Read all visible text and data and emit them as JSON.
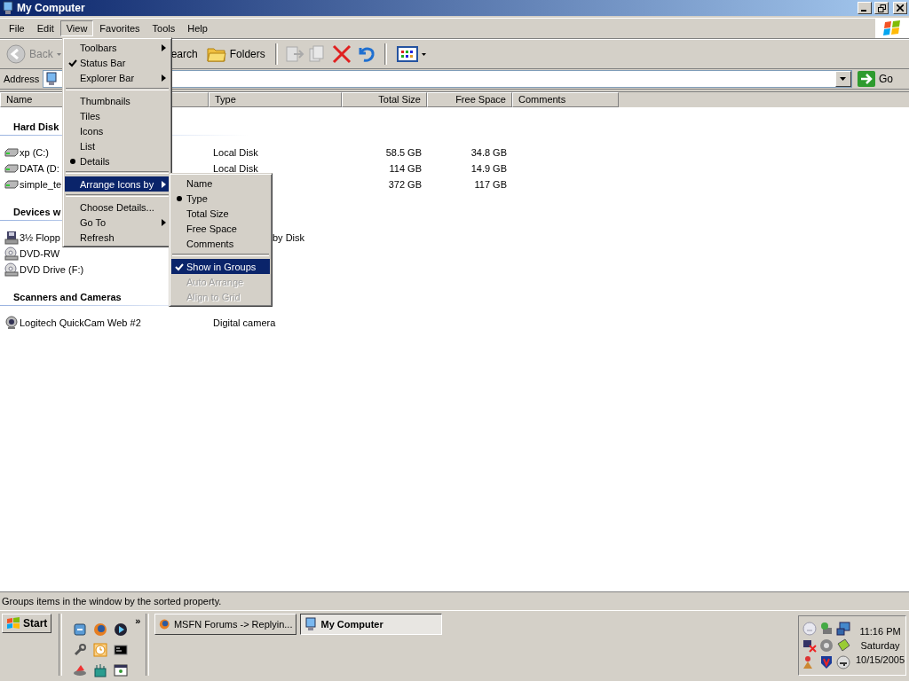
{
  "window": {
    "title": "My Computer"
  },
  "menu_bar": [
    {
      "label": "File",
      "selected": false
    },
    {
      "label": "Edit",
      "selected": false
    },
    {
      "label": "View",
      "selected": true
    },
    {
      "label": "Favorites",
      "selected": false
    },
    {
      "label": "Tools",
      "selected": false
    },
    {
      "label": "Help",
      "selected": false
    }
  ],
  "toolbar": {
    "back": "Back",
    "search": "earch",
    "folders": "Folders"
  },
  "address": {
    "label": "Address",
    "go": "Go"
  },
  "columns": [
    "Name",
    "Type",
    "Total Size",
    "Free Space",
    "Comments"
  ],
  "groups": [
    {
      "title": "Hard Disk",
      "items": [
        {
          "kind": "disk",
          "name": "xp (C:)",
          "type": "Local Disk",
          "total": "58.5 GB",
          "free": "34.8 GB"
        },
        {
          "kind": "disk",
          "name": "DATA (D:",
          "type": "Local Disk",
          "total": "114 GB",
          "free": "14.9 GB"
        },
        {
          "kind": "disk",
          "name": "simple_te",
          "total": "372 GB",
          "free": "117 GB"
        }
      ]
    },
    {
      "title": "Devices w",
      "items": [
        {
          "kind": "floppy",
          "name": "3½ Flopp",
          "type": "by Disk"
        },
        {
          "kind": "dvd",
          "name": "DVD-RW"
        },
        {
          "kind": "dvd",
          "name": "DVD Drive (F:)"
        }
      ]
    },
    {
      "title": "Scanners and Cameras",
      "items": [
        {
          "kind": "camera",
          "name": "Logitech QuickCam Web #2",
          "type": "Digital camera"
        }
      ]
    }
  ],
  "view_menu": {
    "items": [
      {
        "kind": "submenu",
        "label": "Toolbars",
        "selected": false,
        "disabled": false
      },
      {
        "kind": "check",
        "label": "Status Bar",
        "checked": true,
        "selected": false,
        "disabled": false
      },
      {
        "kind": "submenu",
        "label": "Explorer Bar",
        "selected": false,
        "disabled": false
      },
      {
        "kind": "separator"
      },
      {
        "kind": "radio",
        "label": "Thumbnails",
        "checked": false,
        "selected": false,
        "disabled": false
      },
      {
        "kind": "radio",
        "label": "Tiles",
        "checked": false,
        "selected": false,
        "disabled": false
      },
      {
        "kind": "radio",
        "label": "Icons",
        "checked": false,
        "selected": false,
        "disabled": false
      },
      {
        "kind": "radio",
        "label": "List",
        "checked": false,
        "selected": false,
        "disabled": false
      },
      {
        "kind": "radio",
        "label": "Details",
        "checked": true,
        "selected": false,
        "disabled": false
      },
      {
        "kind": "separator"
      },
      {
        "kind": "submenu",
        "label": "Arrange Icons by",
        "selected": true,
        "disabled": false
      },
      {
        "kind": "separator"
      },
      {
        "kind": "item",
        "label": "Choose Details...",
        "selected": false,
        "disabled": false
      },
      {
        "kind": "submenu",
        "label": "Go To",
        "selected": false,
        "disabled": false
      },
      {
        "kind": "item",
        "label": "Refresh",
        "selected": false,
        "disabled": false
      }
    ]
  },
  "arrange_menu": {
    "items": [
      {
        "kind": "radio",
        "label": "Name",
        "checked": false,
        "selected": false,
        "disabled": false
      },
      {
        "kind": "radio",
        "label": "Type",
        "checked": true,
        "selected": false,
        "disabled": false
      },
      {
        "kind": "radio",
        "label": "Total Size",
        "checked": false,
        "selected": false,
        "disabled": false
      },
      {
        "kind": "radio",
        "label": "Free Space",
        "checked": false,
        "selected": false,
        "disabled": false
      },
      {
        "kind": "radio",
        "label": "Comments",
        "checked": false,
        "selected": false,
        "disabled": false
      },
      {
        "kind": "separator"
      },
      {
        "kind": "check",
        "label": "Show in Groups",
        "checked": true,
        "selected": true,
        "disabled": false
      },
      {
        "kind": "check",
        "label": "Auto Arrange",
        "checked": false,
        "selected": false,
        "disabled": true
      },
      {
        "kind": "check",
        "label": "Align to Grid",
        "checked": false,
        "selected": false,
        "disabled": true
      }
    ]
  },
  "status_bar": "Groups items in the window by the sorted property.",
  "taskbar": {
    "start": "Start",
    "chevron": "»",
    "tasks": [
      {
        "label": "MSFN Forums -> Replyin...",
        "selected": false
      },
      {
        "label": "My Computer",
        "selected": true
      }
    ],
    "clock": [
      "11:16 PM",
      "Saturday",
      "10/15/2005"
    ]
  }
}
